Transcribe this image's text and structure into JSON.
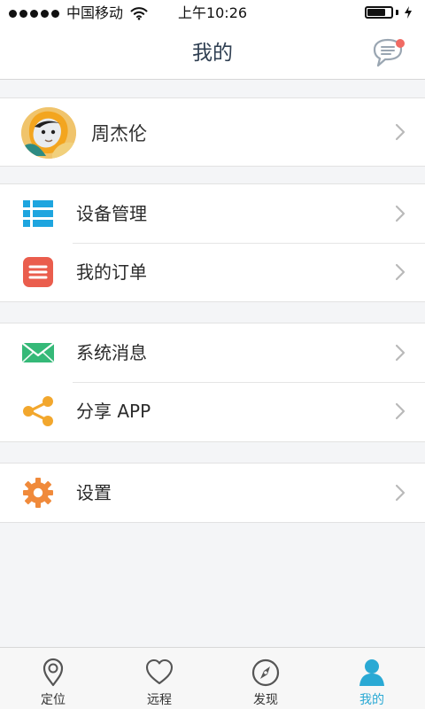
{
  "status_bar": {
    "carrier": "中国移动",
    "time": "上午10:26",
    "battery_level_percent": 75,
    "icons": [
      "signal-dots-icon",
      "wifi-icon",
      "battery-icon",
      "charging-bolt-icon"
    ]
  },
  "header": {
    "title": "我的",
    "message_icon": "chat-bubble-icon",
    "notification_dot_color": "#f06a63"
  },
  "profile": {
    "name": "周杰伦",
    "avatar_icon": "user-avatar-photo"
  },
  "menu_groups": [
    {
      "items": [
        {
          "label": "设备管理",
          "icon": "device-list-icon",
          "color": "#1ea5df"
        },
        {
          "label": "我的订单",
          "icon": "order-list-icon",
          "color": "#ea5d4d"
        }
      ]
    },
    {
      "items": [
        {
          "label": "系统消息",
          "icon": "mail-icon",
          "color": "#35b978"
        },
        {
          "label": "分享 APP",
          "icon": "share-icon",
          "color": "#f2a72d"
        }
      ]
    },
    {
      "items": [
        {
          "label": "设置",
          "icon": "gear-icon",
          "color": "#f08a3b"
        }
      ]
    }
  ],
  "tabbar": {
    "active_color": "#2aa9d4",
    "items": [
      {
        "label": "定位",
        "icon": "location-pin-icon",
        "active": false
      },
      {
        "label": "远程",
        "icon": "heart-icon",
        "active": false
      },
      {
        "label": "发现",
        "icon": "compass-icon",
        "active": false
      },
      {
        "label": "我的",
        "icon": "person-icon",
        "active": true
      }
    ]
  }
}
